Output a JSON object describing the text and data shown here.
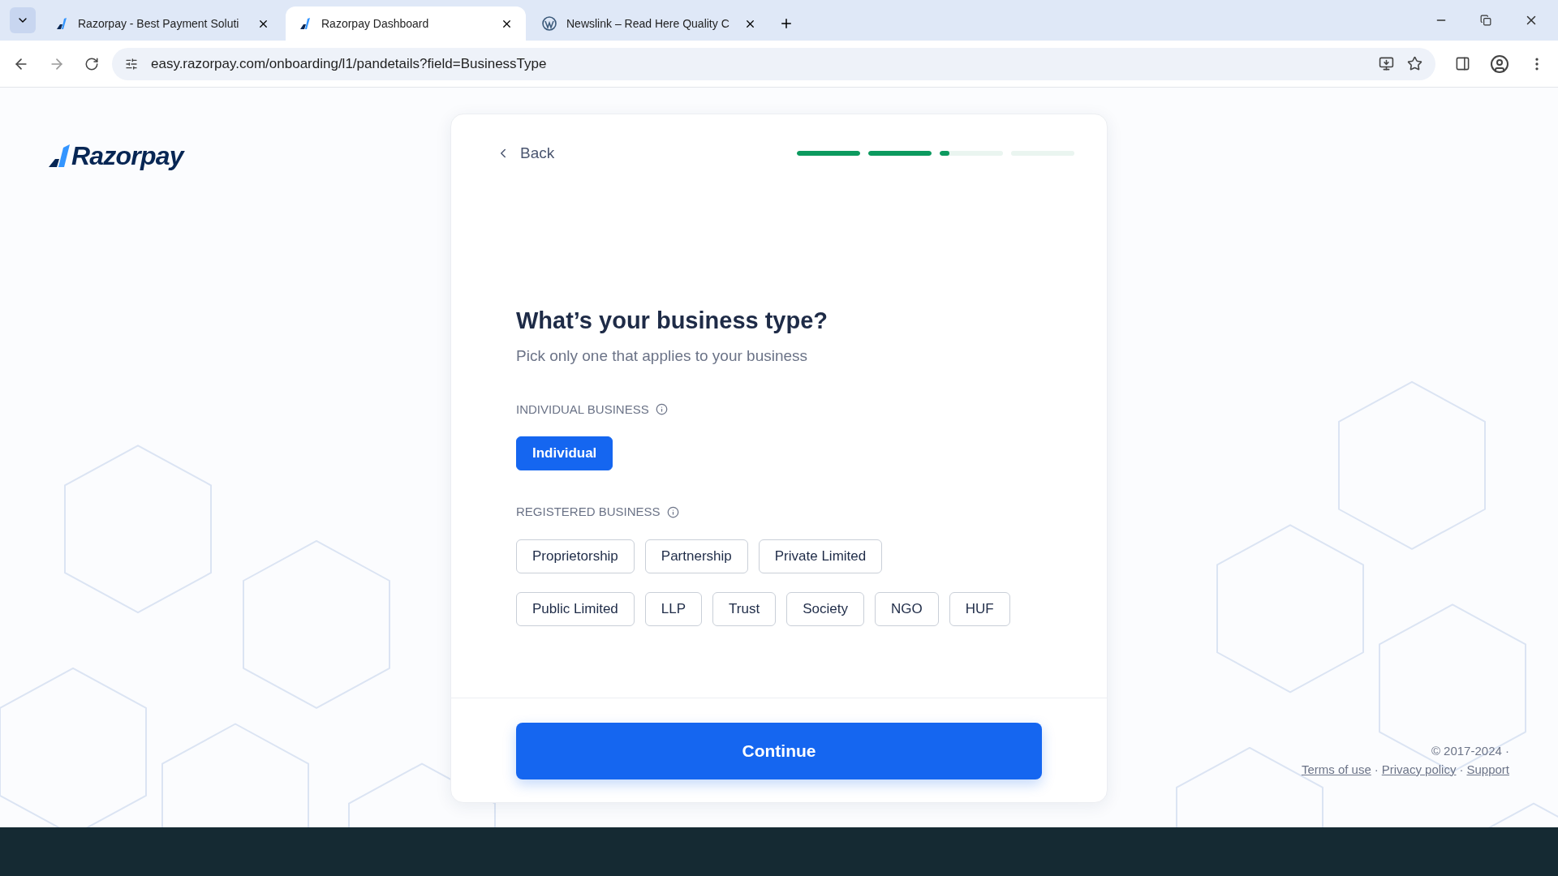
{
  "browser": {
    "tabs": [
      {
        "title": "Razorpay - Best Payment Soluti",
        "kind": "razorpay",
        "selected": false
      },
      {
        "title": "Razorpay Dashboard",
        "kind": "razorpay",
        "selected": true
      },
      {
        "title": "Newslink – Read Here Quality C",
        "kind": "wordpress",
        "selected": false
      }
    ],
    "url": "easy.razorpay.com/onboarding/l1/pandetails?field=BusinessType"
  },
  "logo": {
    "text": "Razorpay"
  },
  "card": {
    "back": "Back",
    "progress": [
      {
        "level": 1
      },
      {
        "level": 1
      },
      {
        "level": 0.15
      },
      {
        "level": 0
      }
    ],
    "title": "What’s your business type?",
    "subtitle": "Pick only one that applies to your business",
    "sections": [
      {
        "label": "INDIVIDUAL BUSINESS",
        "lines": [
          {
            "options": [
              {
                "label": "Individual",
                "selected": true
              }
            ]
          }
        ]
      },
      {
        "label": "REGISTERED BUSINESS",
        "lines": [
          {
            "options": [
              {
                "label": "Proprietorship",
                "selected": false
              },
              {
                "label": "Partnership",
                "selected": false
              },
              {
                "label": "Private Limited",
                "selected": false
              }
            ]
          },
          {
            "options": [
              {
                "label": "Public Limited",
                "selected": false
              },
              {
                "label": "LLP",
                "selected": false
              },
              {
                "label": "Trust",
                "selected": false
              },
              {
                "label": "Society",
                "selected": false
              },
              {
                "label": "NGO",
                "selected": false
              },
              {
                "label": "HUF",
                "selected": false
              }
            ]
          }
        ]
      }
    ],
    "continue": "Continue"
  },
  "footer": {
    "copyright": "© 2017-2024 ·",
    "links": [
      "Terms of use",
      "Privacy policy",
      "Support"
    ],
    "separator": "·"
  }
}
